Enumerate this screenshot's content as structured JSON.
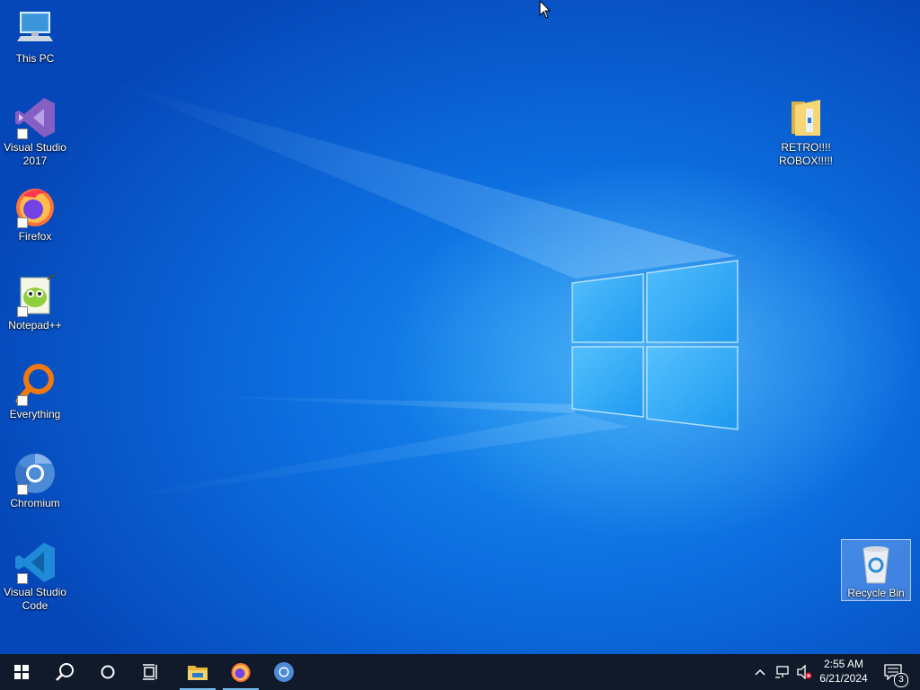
{
  "desktop": {
    "icons": [
      {
        "label": "This PC",
        "icon": "this-pc-icon"
      },
      {
        "label": "Visual Studio\n2017",
        "icon": "visual-studio-icon"
      },
      {
        "label": "Firefox",
        "icon": "firefox-icon"
      },
      {
        "label": "Notepad++",
        "icon": "notepad-plus-plus-icon"
      },
      {
        "label": "Everything",
        "icon": "everything-search-icon"
      },
      {
        "label": "Chromium",
        "icon": "chromium-icon"
      },
      {
        "label": "Visual Studio\nCode",
        "icon": "vscode-icon"
      },
      {
        "label": "RETRO!!!!\nROBOX!!!!!",
        "icon": "folder-icon"
      },
      {
        "label": "Recycle Bin",
        "icon": "recycle-bin-icon"
      }
    ]
  },
  "taskbar": {
    "buttons": [
      {
        "name": "start-button",
        "icon": "windows-logo-icon"
      },
      {
        "name": "search-button",
        "icon": "search-icon"
      },
      {
        "name": "cortana-button",
        "icon": "cortana-circle-icon"
      },
      {
        "name": "task-view-button",
        "icon": "task-view-icon"
      },
      {
        "name": "file-explorer-button",
        "icon": "file-explorer-icon",
        "active": true
      },
      {
        "name": "firefox-taskbar-button",
        "icon": "firefox-icon",
        "active": true
      },
      {
        "name": "chromium-taskbar-button",
        "icon": "chromium-icon"
      }
    ],
    "tray": {
      "time": "2:55 AM",
      "date": "6/21/2024",
      "notification_count": "3"
    }
  },
  "colors": {
    "taskbar_bg": "#101a2b",
    "desktop_accent": "#0d6fe0",
    "active_indicator": "#76b9ed"
  }
}
